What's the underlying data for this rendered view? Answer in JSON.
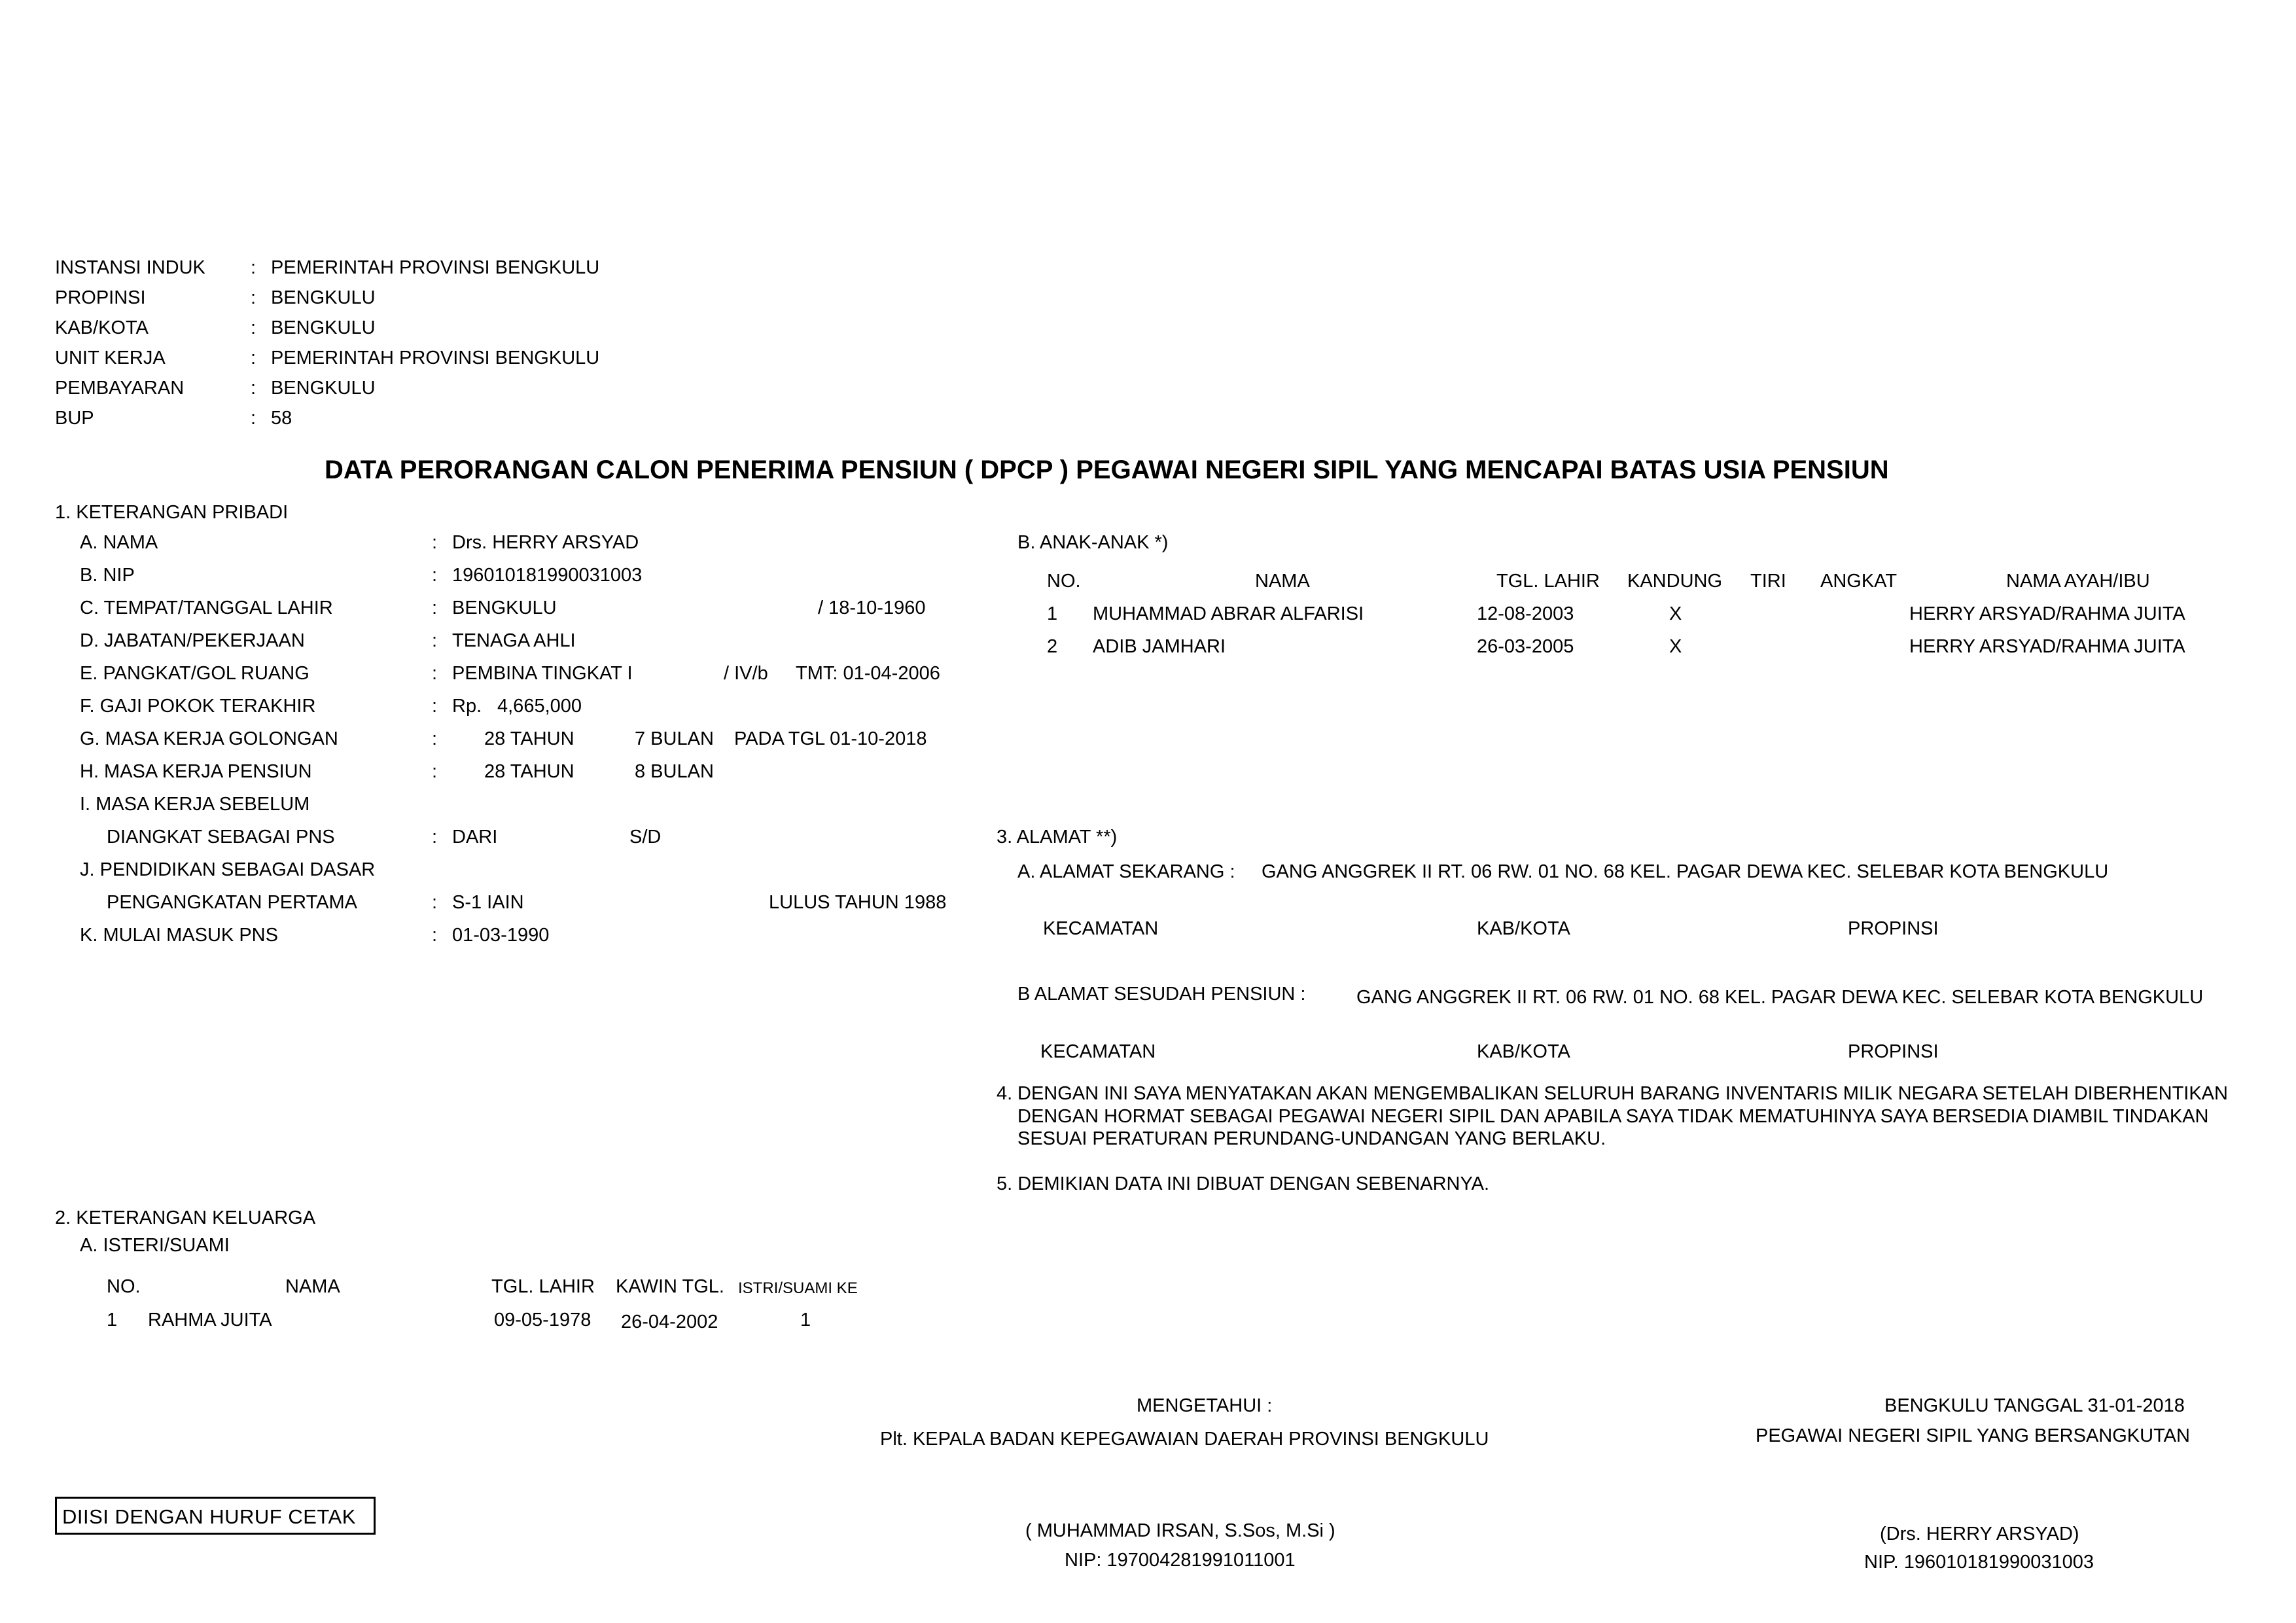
{
  "header": {
    "rows": [
      {
        "label": "INSTANSI INDUK",
        "sep": ":",
        "value": "PEMERINTAH PROVINSI BENGKULU"
      },
      {
        "label": "PROPINSI",
        "sep": ":",
        "value": "BENGKULU"
      },
      {
        "label": "KAB/KOTA",
        "sep": ":",
        "value": "BENGKULU"
      },
      {
        "label": "UNIT KERJA",
        "sep": ":",
        "value": "PEMERINTAH PROVINSI BENGKULU"
      },
      {
        "label": "PEMBAYARAN",
        "sep": ":",
        "value": "BENGKULU"
      },
      {
        "label": "BUP",
        "sep": ":",
        "value": "58"
      }
    ]
  },
  "title": "DATA PERORANGAN CALON PENERIMA PENSIUN ( DPCP ) PEGAWAI NEGERI SIPIL YANG MENCAPAI BATAS USIA PENSIUN",
  "pribadi": {
    "heading": "1. KETERANGAN PRIBADI",
    "sep": ":",
    "a_label": "A.  NAMA",
    "a_value": "Drs. HERRY ARSYAD",
    "b_label": "B.  NIP",
    "b_value": "196010181990031003",
    "c_label": "C.  TEMPAT/TANGGAL LAHIR",
    "c_place": "BENGKULU",
    "c_date": "/  18-10-1960",
    "d_label": "D.  JABATAN/PEKERJAAN",
    "d_value": "TENAGA AHLI",
    "e_label": "E.  PANGKAT/GOL RUANG",
    "e_value": "PEMBINA TINGKAT I",
    "e_gol": "/  IV/b",
    "e_tmt": "TMT:  01-04-2006",
    "f_label": "F.  GAJI POKOK TERAKHIR",
    "f_rp": "Rp.",
    "f_value": "4,665,000",
    "g_label": "G.  MASA KERJA GOLONGAN",
    "g_tahun": "28 TAHUN",
    "g_bulan": "7 BULAN",
    "g_tgl": "PADA TGL  01-10-2018",
    "h_label": "H.  MASA KERJA PENSIUN",
    "h_tahun": "28 TAHUN",
    "h_bulan": "8 BULAN",
    "i_label1": "I.   MASA KERJA SEBELUM",
    "i_label2": "DIANGKAT SEBAGAI PNS",
    "i_dari": "DARI",
    "i_sd": "S/D",
    "j_label1": "J.  PENDIDIKAN SEBAGAI DASAR",
    "j_label2": "PENGANGKATAN PERTAMA",
    "j_value": "S-1 IAIN",
    "j_lulus": "LULUS TAHUN  1988",
    "k_label": "K.  MULAI MASUK PNS",
    "k_value": "01-03-1990"
  },
  "anak": {
    "heading": "B.  ANAK-ANAK *)",
    "columns": [
      "NO.",
      "NAMA",
      "TGL. LAHIR",
      "KANDUNG",
      "TIRI",
      "ANGKAT",
      "NAMA AYAH/IBU"
    ],
    "rows": [
      [
        "1",
        "MUHAMMAD ABRAR ALFARISI",
        "12-08-2003",
        "X",
        "",
        "",
        "HERRY ARSYAD/RAHMA JUITA"
      ],
      [
        "2",
        "ADIB JAMHARI",
        "26-03-2005",
        "X",
        "",
        "",
        "HERRY ARSYAD/RAHMA JUITA"
      ]
    ]
  },
  "alamat": {
    "heading": "3. ALAMAT **)",
    "sekarang_label": "A.  ALAMAT SEKARANG :",
    "sekarang_value": "GANG ANGGREK II RT. 06 RW. 01 NO. 68 KEL. PAGAR DEWA KEC. SELEBAR KOTA BENGKULU",
    "sesudah_label": "B  ALAMAT SESUDAH PENSIUN :",
    "sesudah_value": "GANG ANGGREK II RT. 06 RW. 01 NO. 68 KEL. PAGAR DEWA KEC. SELEBAR KOTA BENGKULU",
    "kecamatan": "KECAMATAN",
    "kabkota": "KAB/KOTA",
    "propinsi": "PROPINSI"
  },
  "pernyataan": {
    "num": "4.",
    "line1": "DENGAN INI SAYA MENYATAKAN AKAN MENGEMBALIKAN SELURUH BARANG INVENTARIS MILIK NEGARA SETELAH DIBERHENTIKAN",
    "line2": "DENGAN HORMAT SEBAGAI PEGAWAI NEGERI SIPIL DAN APABILA SAYA TIDAK MEMATUHINYA SAYA BERSEDIA DIAMBIL TINDAKAN",
    "line3": "SESUAI PERATURAN PERUNDANG-UNDANGAN YANG BERLAKU."
  },
  "demikian": "5.  DEMIKIAN DATA INI DIBUAT DENGAN SEBENARNYA.",
  "keluarga": {
    "heading": "2. KETERANGAN KELUARGA",
    "sub": "A.  ISTERI/SUAMI",
    "col_no": "NO.",
    "col_nama": "NAMA",
    "col_tgl": "TGL. LAHIR",
    "col_kawin": "KAWIN TGL.",
    "col_ke": "ISTRI/SUAMI KE",
    "rows": [
      [
        "1",
        "RAHMA JUITA",
        "09-05-1978",
        "26-04-2002",
        "1"
      ]
    ]
  },
  "mengetahui": {
    "label": "MENGETAHUI :",
    "jabatan": "Plt. KEPALA BADAN KEPEGAWAIAN DAERAH PROVINSI BENGKULU",
    "nama": "( MUHAMMAD IRSAN, S.Sos, M.Si )",
    "nip": "NIP: 197004281991011001"
  },
  "bersangkutan": {
    "tanggal": "BENGKULU TANGGAL 31-01-2018",
    "jabatan": "PEGAWAI NEGERI SIPIL YANG BERSANGKUTAN",
    "nama": "(Drs. HERRY ARSYAD)",
    "nip": "NIP. 196010181990031003"
  },
  "note_box": "DIISI DENGAN HURUF CETAK"
}
